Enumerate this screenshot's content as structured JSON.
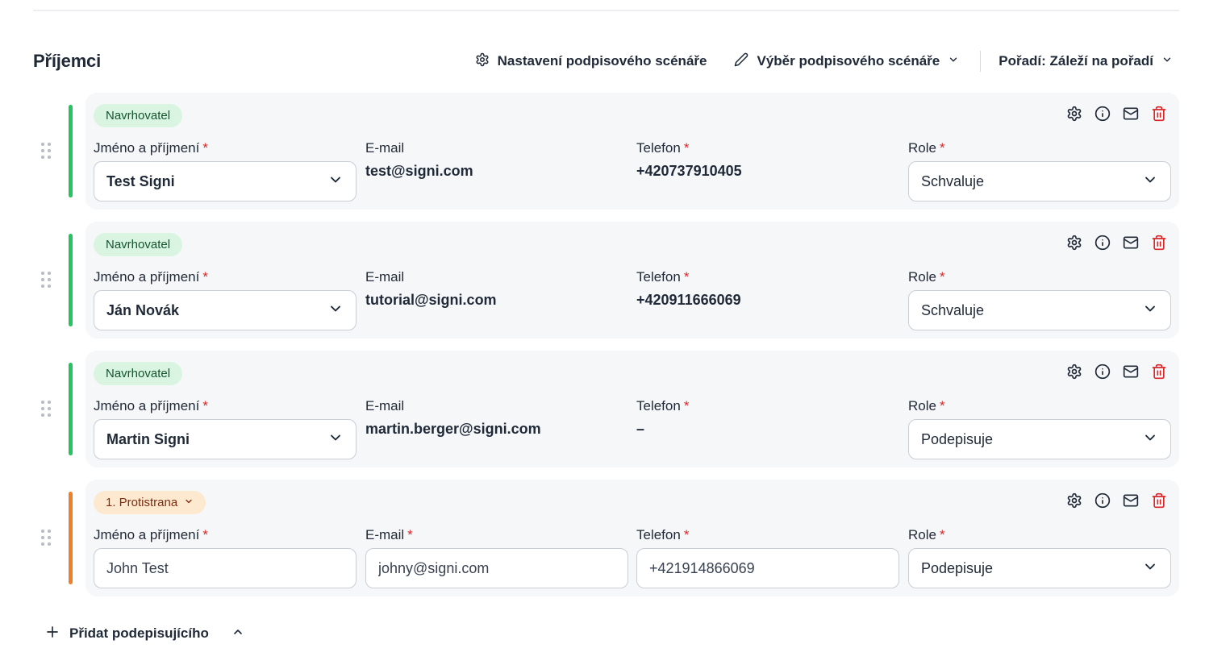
{
  "section": {
    "title": "Příjemci"
  },
  "header_actions": {
    "scenario_settings": "Nastavení podpisového scénáře",
    "scenario_select": "Výběr podpisového scénáře",
    "order": "Pořadí: Záleží na pořadí"
  },
  "labels": {
    "name": "Jméno a příjmení",
    "email": "E-mail",
    "phone": "Telefon",
    "role": "Role",
    "required_mark": "*"
  },
  "colors": {
    "proposer_stripe": "#22c55e",
    "counterparty_stripe": "#f07f2a",
    "delete_icon": "#dc2626"
  },
  "recipients": [
    {
      "badge": "Navrhovatel",
      "badge_type": "proposer",
      "name": "Test Signi",
      "email": "test@signi.com",
      "phone": "+420737910405",
      "role": "Schvaluje"
    },
    {
      "badge": "Navrhovatel",
      "badge_type": "proposer",
      "name": "Ján Novák",
      "email": "tutorial@signi.com",
      "phone": "+420911666069",
      "role": "Schvaluje"
    },
    {
      "badge": "Navrhovatel",
      "badge_type": "proposer",
      "name": "Martin Signi",
      "email": "martin.berger@signi.com",
      "phone": "–",
      "role": "Podepisuje"
    },
    {
      "badge": "1. Protistrana",
      "badge_type": "counterparty",
      "name": "John Test",
      "email": "johny@signi.com",
      "phone": "+421914866069",
      "role": "Podepisuje"
    }
  ],
  "footer": {
    "add_signer": "Přidat podepisujícího"
  },
  "icons": {
    "scenario_settings": "gear-icon",
    "scenario_select": "pencil-icon",
    "dropdown": "chevron-down-icon",
    "row_settings": "gear-icon",
    "row_info": "info-icon",
    "row_mail": "mail-icon",
    "row_delete": "trash-icon",
    "drag": "drag-handle-icon",
    "add": "plus-icon",
    "collapse": "chevron-up-icon"
  }
}
